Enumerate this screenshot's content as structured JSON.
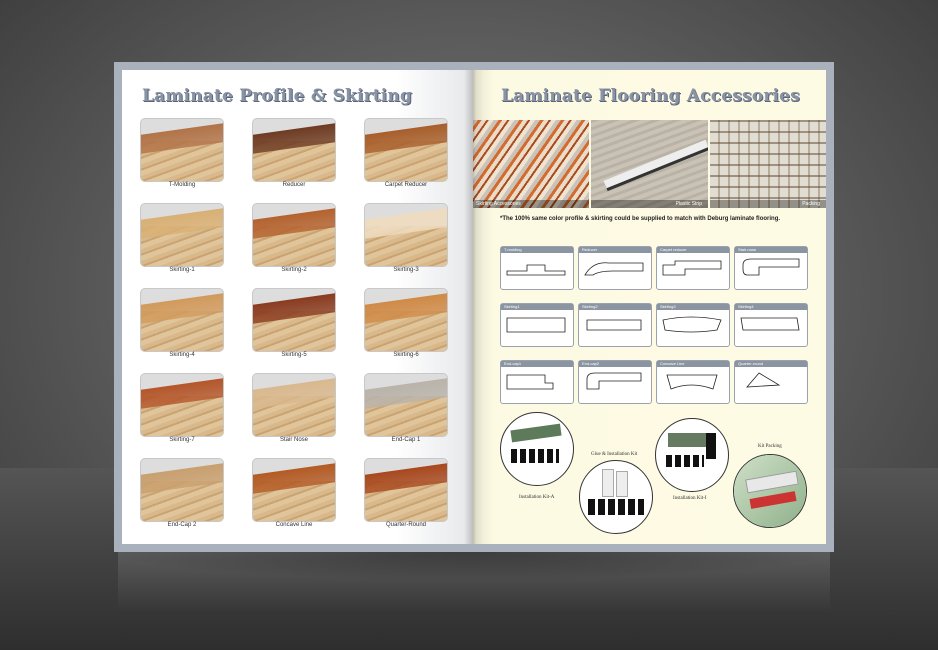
{
  "left_page": {
    "title": "Laminate Profile & Skirting",
    "items": [
      "T-Molding",
      "Reducer",
      "Carpet Reducer",
      "Skirting-1",
      "Skirting-2",
      "Skirting-3",
      "Skirting-4",
      "Skirting-5",
      "Skirting-6",
      "Skirting-7",
      "Stair Nose",
      "End-Cap 1",
      "End-Cap 2",
      "Concave Line",
      "Quarter-Round"
    ]
  },
  "right_page": {
    "title": "Laminate Flooring Accessories",
    "photos": [
      "Skirting Accessories",
      "Plastic Strip",
      "Packing"
    ],
    "note": "*The 100% same color profile & skirting could be supplied to match with Deburg laminate flooring.",
    "profiles": [
      "T-molding",
      "Reducer",
      "Carpet reducer",
      "Stair-nose",
      "Skirting1",
      "Skirting2",
      "Skirting3",
      "Skirting4",
      "End-cap1",
      "End-cap2",
      "Concave Line",
      "Quarter-round"
    ],
    "kits": {
      "kit_a": "Installation Kit-A",
      "glue": "Glue & Installation Kit",
      "kit_i": "Installation Kit-I",
      "packing": "Kit Packing"
    }
  },
  "colors": {
    "title": "#8893a5",
    "right_page_bg": "#fefbe4",
    "binding": "#a9b1bd"
  }
}
